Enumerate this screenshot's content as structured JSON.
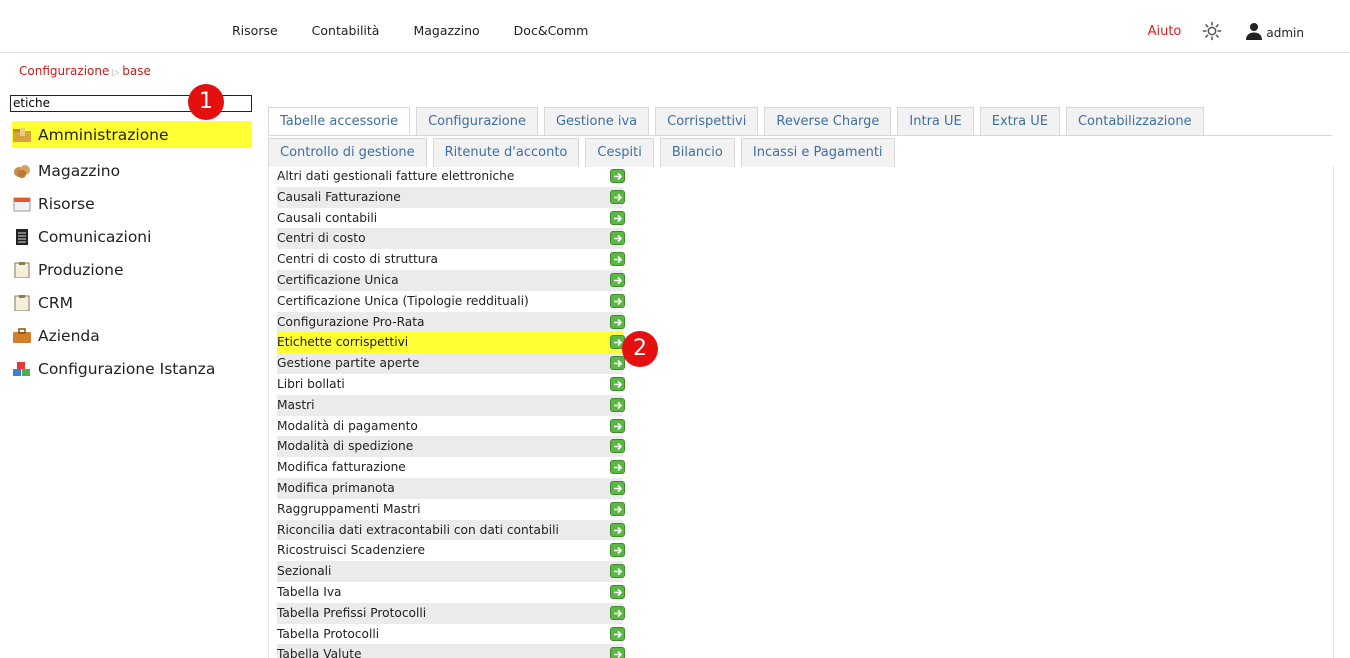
{
  "topnav": {
    "items": [
      "Risorse",
      "Contabilità",
      "Magazzino",
      "Doc&Comm"
    ]
  },
  "topright": {
    "help": "Aiuto",
    "user": "admin"
  },
  "breadcrumb": {
    "root": "Configurazione",
    "current": "base"
  },
  "search": {
    "value": "etiche"
  },
  "badges": {
    "first": "1",
    "second": "2"
  },
  "sidebar": {
    "items": [
      {
        "label": "Amministrazione",
        "icon": "folder-money-icon",
        "highlighted": true
      },
      {
        "label": "Magazzino",
        "icon": "boxes-icon"
      },
      {
        "label": "Risorse",
        "icon": "calendar-icon"
      },
      {
        "label": "Comunicazioni",
        "icon": "notepad-icon"
      },
      {
        "label": "Produzione",
        "icon": "clipboard-icon"
      },
      {
        "label": "CRM",
        "icon": "clipboard-icon"
      },
      {
        "label": "Azienda",
        "icon": "briefcase-icon"
      },
      {
        "label": "Configurazione Istanza",
        "icon": "blocks-icon"
      }
    ]
  },
  "tabs": {
    "row1": [
      "Tabelle accessorie",
      "Configurazione",
      "Gestione iva",
      "Corrispettivi",
      "Reverse Charge",
      "Intra UE",
      "Extra UE",
      "Contabilizzazione"
    ],
    "row2": [
      "Controllo di gestione",
      "Ritenute d'acconto",
      "Cespiti",
      "Bilancio",
      "Incassi e Pagamenti"
    ],
    "active": "Tabelle accessorie"
  },
  "table": {
    "rows": [
      "Altri dati gestionali fatture elettroniche",
      "Causali Fatturazione",
      "Causali contabili",
      "Centri di costo",
      "Centri di costo di struttura",
      "Certificazione Unica",
      "Certificazione Unica (Tipologie reddituali)",
      "Configurazione Pro-Rata",
      "Etichette corrispettivi",
      "Gestione partite aperte",
      "Libri bollati",
      "Mastri",
      "Modalità di pagamento",
      "Modalità di spedizione",
      "Modifica fatturazione",
      "Modifica primanota",
      "Raggruppamenti Mastri",
      "Riconcilia dati extracontabili con dati contabili",
      "Ricostruisci Scadenziere",
      "Sezionali",
      "Tabella Iva",
      "Tabella Prefissi Protocolli",
      "Tabella Protocolli",
      "Tabella Valute"
    ],
    "highlighted_row": "Etichette corrispettivi"
  },
  "colors": {
    "accent_red": "#e3100f",
    "highlight": "#ffff33",
    "go_green": "#5cb845",
    "tab_text": "#3f6fa0"
  }
}
